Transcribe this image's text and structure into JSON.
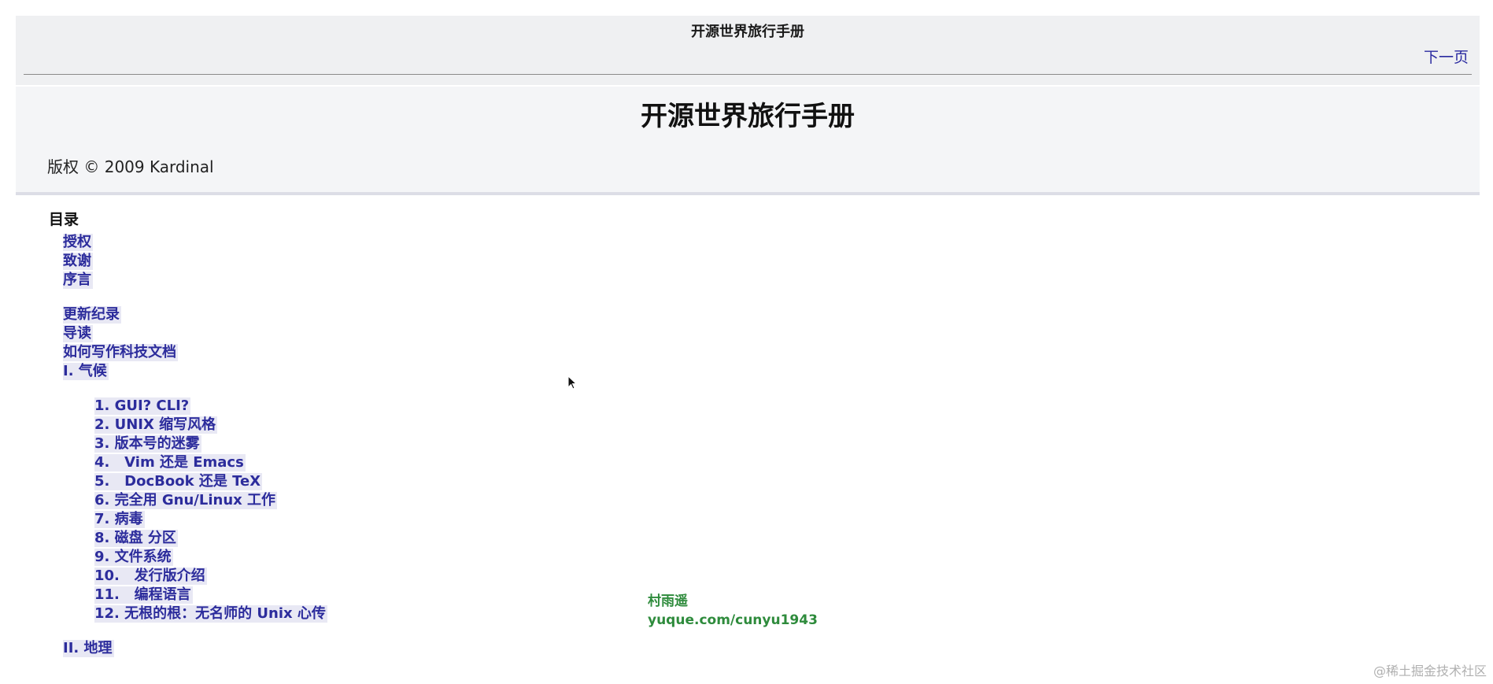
{
  "navheader": {
    "title": "开源世界旅行手册",
    "next_label": "下一页"
  },
  "titlepage": {
    "title": "开源世界旅行手册",
    "copyright": "版权 © 2009 Kardinal"
  },
  "toc": {
    "heading": "目录",
    "items": [
      {
        "label": "授权",
        "level": 1
      },
      {
        "label": "致谢",
        "level": 1
      },
      {
        "label": "序言",
        "level": 1
      },
      {
        "label": "更新纪录",
        "level": 1
      },
      {
        "label": "导读",
        "level": 1
      },
      {
        "label": "如何写作科技文档",
        "level": 1
      },
      {
        "label": "I. 气候",
        "level": 1
      },
      {
        "label": "1. GUI? CLI?",
        "level": 2
      },
      {
        "label": "2. UNIX 缩写风格",
        "level": 2
      },
      {
        "label": "3. 版本号的迷雾",
        "level": 2
      },
      {
        "label": "4.   Vim 还是 Emacs",
        "level": 2
      },
      {
        "label": "5.   DocBook 还是 TeX",
        "level": 2
      },
      {
        "label": "6. 完全用 Gnu/Linux 工作",
        "level": 2
      },
      {
        "label": "7. 病毒",
        "level": 2
      },
      {
        "label": "8. 磁盘 分区",
        "level": 2
      },
      {
        "label": "9. 文件系统",
        "level": 2
      },
      {
        "label": "10.   发行版介绍",
        "level": 2
      },
      {
        "label": "11.   编程语言",
        "level": 2
      },
      {
        "label": "12. 无根的根：无名师的 Unix 心传",
        "level": 2
      },
      {
        "label": "II. 地理",
        "level": 1
      }
    ]
  },
  "watermark": {
    "line1": "村雨遥",
    "line2": "yuque.com/cunyu1943"
  },
  "source_mark": "@稀土掘金技术社区",
  "colors": {
    "link": "#2c2c9c",
    "link_bg": "#e8e8f4",
    "header_bg": "#eff0f2",
    "watermark": "#2e8b3c"
  }
}
